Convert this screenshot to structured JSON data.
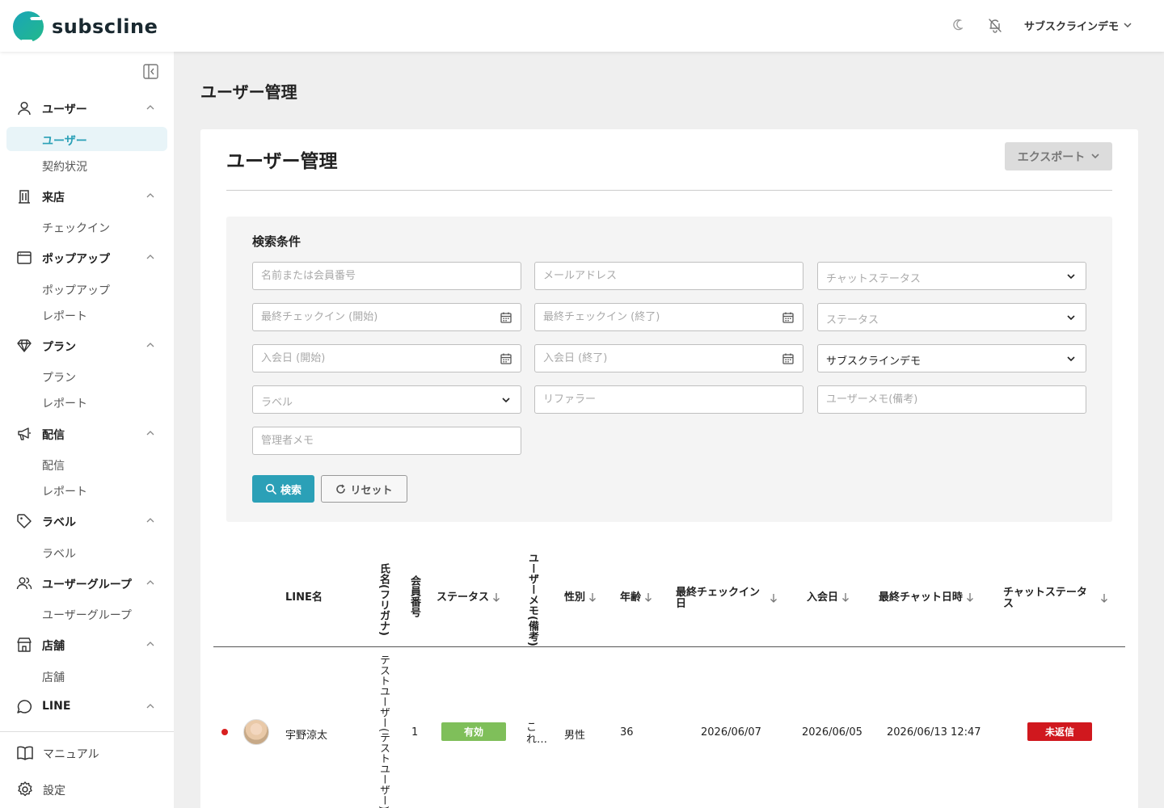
{
  "header": {
    "logo_text": "subscline",
    "theme_icon": "moon-icon",
    "notification_icon": "bell-off-icon",
    "account_name": "サブスクラインデモ"
  },
  "sidebar": {
    "sections": [
      {
        "label": "ユーザー",
        "icon": "user-icon",
        "items": [
          "ユーザー",
          "契約状況"
        ]
      },
      {
        "label": "来店",
        "icon": "building-icon",
        "items": [
          "チェックイン"
        ]
      },
      {
        "label": "ポップアップ",
        "icon": "browser-window-icon",
        "items": [
          "ポップアップ",
          "レポート"
        ]
      },
      {
        "label": "プラン",
        "icon": "diamond-icon",
        "items": [
          "プラン",
          "レポート"
        ]
      },
      {
        "label": "配信",
        "icon": "megaphone-icon",
        "items": [
          "配信",
          "レポート"
        ]
      },
      {
        "label": "ラベル",
        "icon": "tag-icon",
        "items": [
          "ラベル"
        ]
      },
      {
        "label": "ユーザーグループ",
        "icon": "users-icon",
        "items": [
          "ユーザーグループ"
        ]
      },
      {
        "label": "店舗",
        "icon": "store-icon",
        "items": [
          "店舗"
        ]
      },
      {
        "label": "LINE",
        "icon": "chat-bubble-icon",
        "items": []
      }
    ],
    "active_item": "ユーザー",
    "bottom": [
      {
        "label": "マニュアル",
        "icon": "book-icon"
      },
      {
        "label": "設定",
        "icon": "gear-icon"
      }
    ]
  },
  "main": {
    "page_title": "ユーザー管理",
    "card_title": "ユーザー管理",
    "export_label": "エクスポート",
    "search": {
      "title": "検索条件",
      "fields": {
        "name": {
          "placeholder": "名前または会員番号"
        },
        "email": {
          "placeholder": "メールアドレス"
        },
        "chat_status": {
          "placeholder": "チャットステータス"
        },
        "checkin_start": {
          "placeholder": "最終チェックイン (開始)"
        },
        "checkin_end": {
          "placeholder": "最終チェックイン (終了)"
        },
        "status": {
          "placeholder": "ステータス"
        },
        "join_start": {
          "placeholder": "入会日 (開始)"
        },
        "join_end": {
          "placeholder": "入会日 (終了)"
        },
        "store": {
          "value": "サブスクラインデモ"
        },
        "label": {
          "placeholder": "ラベル"
        },
        "referrer": {
          "placeholder": "リファラー"
        },
        "user_memo": {
          "placeholder": "ユーザーメモ(備考)"
        },
        "admin_memo": {
          "placeholder": "管理者メモ"
        }
      },
      "search_label": "検索",
      "reset_label": "リセット"
    },
    "table": {
      "columns": {
        "line_name": "LINE名",
        "kana": "氏名(フリガナ)",
        "member_no": "会員番号",
        "status": "ステータス",
        "user_memo": "ユーザーメモ(備考)",
        "gender": "性別",
        "age": "年齢",
        "last_checkin": "最終チェックイン日",
        "join_date": "入会日",
        "last_chat": "最終チャット日時",
        "chat_status": "チャットステータス"
      },
      "rows": [
        {
          "line_name": "宇野涼太",
          "kana": "テストユーザー(テストユーザー)",
          "member_no": "1",
          "status": "有効",
          "user_memo": "これ…",
          "gender": "男性",
          "age": "36",
          "last_checkin": "2026/06/07",
          "join_date": "2026/06/05",
          "last_chat": "2026/06/13 12:47",
          "chat_status": "未返信"
        }
      ]
    }
  },
  "colors": {
    "accent": "#2ba0b7",
    "status_active": "#7fbf5a",
    "status_unreplied": "#d0181e",
    "unread_dot": "#d81f1f"
  }
}
